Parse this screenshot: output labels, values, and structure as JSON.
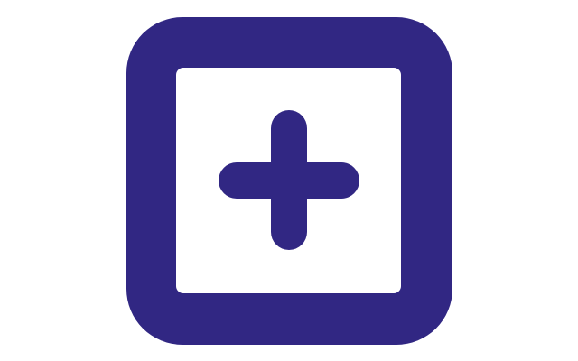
{
  "icon": {
    "name": "add-square-icon",
    "color": "#312783",
    "background": "#ffffff"
  }
}
